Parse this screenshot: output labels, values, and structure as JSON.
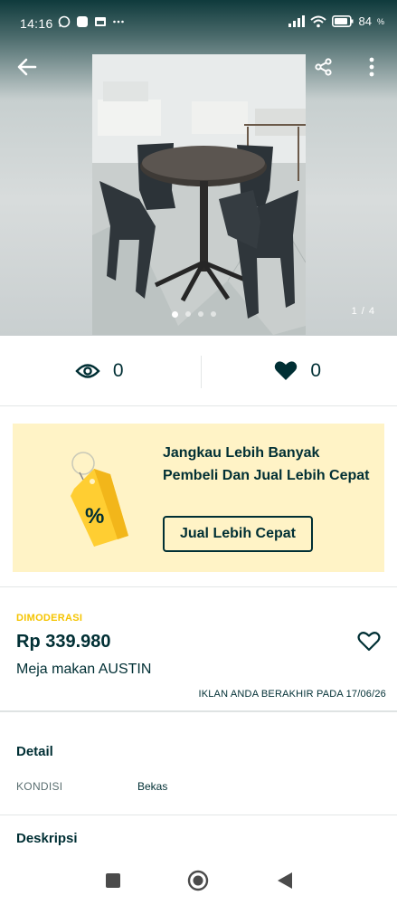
{
  "status_bar": {
    "time": "14:16",
    "battery": "84",
    "left_icons": [
      "whatsapp-icon",
      "app-icon",
      "gallery-icon",
      "more-dots-icon"
    ],
    "right_icons": [
      "signal-icon",
      "wifi-icon",
      "battery-icon"
    ]
  },
  "gallery": {
    "counter": "1 / 4",
    "current_index": 1,
    "total": 4
  },
  "stats": {
    "views": "0",
    "likes": "0"
  },
  "promo": {
    "title": "Jangkau Lebih Banyak Pembeli Dan Jual Lebih Cepat",
    "button_label": "Jual Lebih Cepat",
    "badge_symbol": "%"
  },
  "listing": {
    "status": "DIMODERASI",
    "price": "Rp 339.980",
    "title": "Meja makan AUSTIN",
    "expiry": "IKLAN ANDA BERAKHIR PADA 17/06/26"
  },
  "details": {
    "heading": "Detail",
    "rows": [
      {
        "label": "KONDISI",
        "value": "Bekas"
      }
    ]
  },
  "description": {
    "heading": "Deskripsi"
  },
  "colors": {
    "primary": "#002f34",
    "promo_bg": "#fff3c6",
    "moderated": "#f5c400",
    "tag": "#ffce32"
  }
}
